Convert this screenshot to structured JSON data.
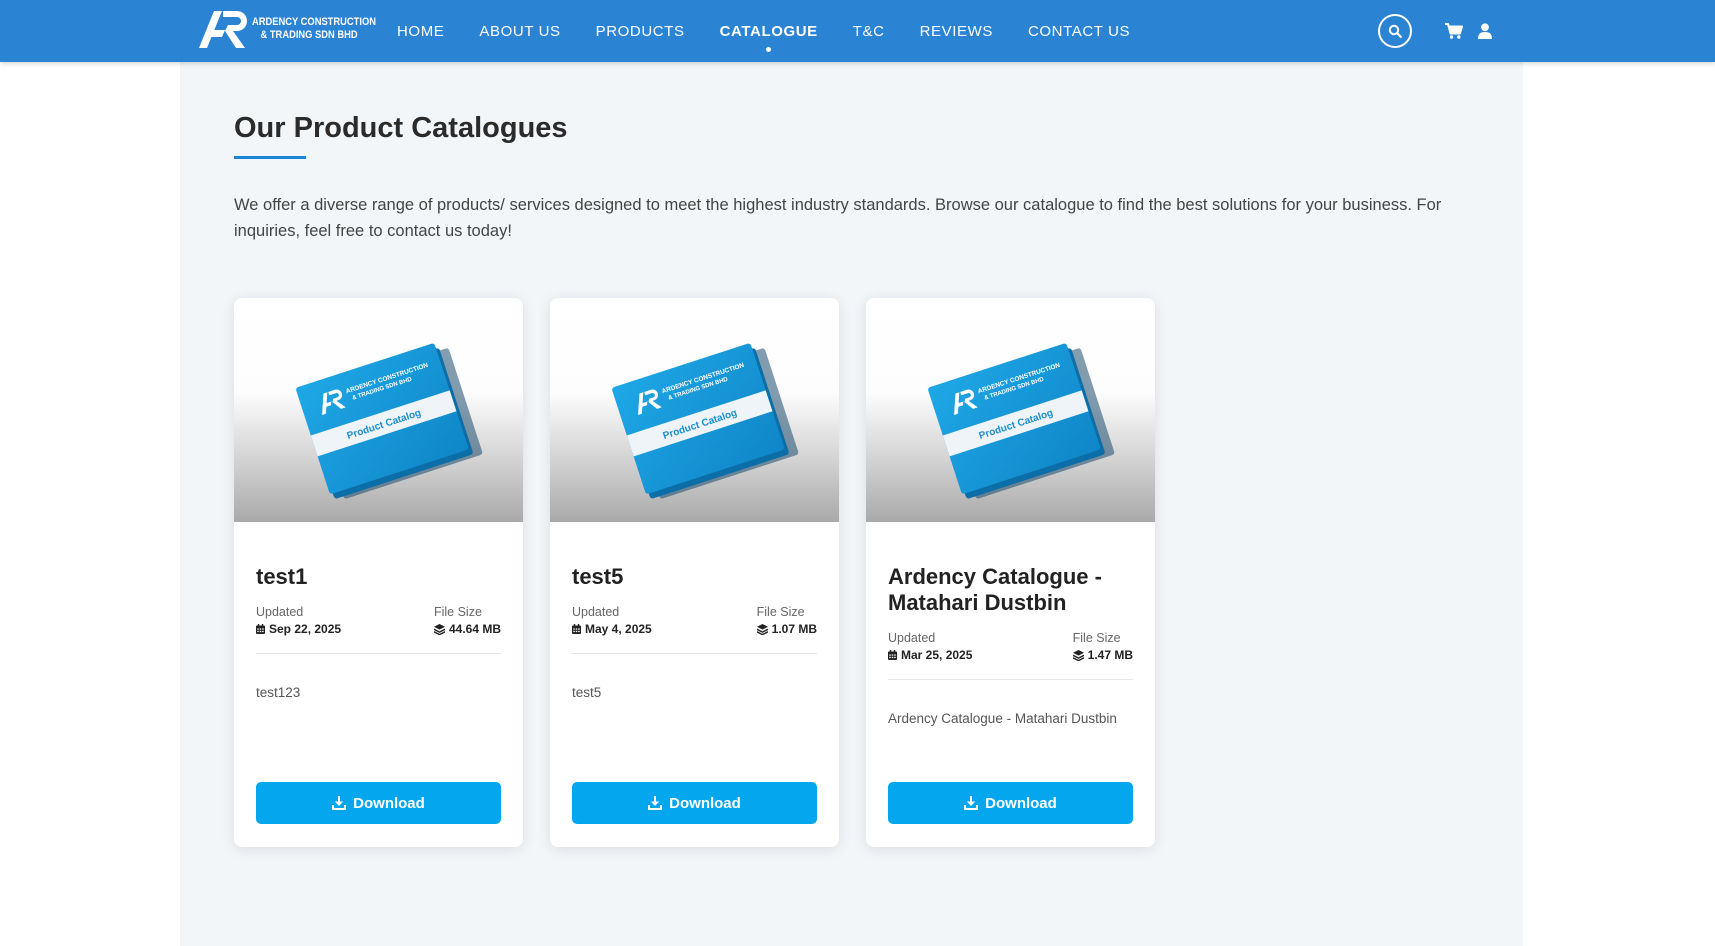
{
  "brand": {
    "logo_letters": "AR",
    "name_line1": "ARDENCY CONSTRUCTION",
    "name_line2": "& TRADING SDN BHD"
  },
  "nav": {
    "items": [
      {
        "label": "HOME",
        "active": false
      },
      {
        "label": "ABOUT US",
        "active": false
      },
      {
        "label": "PRODUCTS",
        "active": false
      },
      {
        "label": "CATALOGUE",
        "active": true
      },
      {
        "label": "T&C",
        "active": false
      },
      {
        "label": "REVIEWS",
        "active": false
      },
      {
        "label": "CONTACT US",
        "active": false
      }
    ],
    "icons": [
      "search-icon",
      "cart-icon",
      "user-icon"
    ]
  },
  "page": {
    "title": "Our Product Catalogues",
    "intro": "We offer a diverse range of products/ services designed to meet the highest industry standards. Browse our catalogue to find the best solutions for your business. For inquiries, feel free to contact us today!"
  },
  "cover": {
    "brand_line1": "ARDENCY CONSTRUCTION",
    "brand_line2": "& TRADING SDN BHD",
    "band_text": "Product Catalog"
  },
  "labels": {
    "updated": "Updated",
    "file_size": "File Size",
    "download": "Download"
  },
  "catalogues": [
    {
      "title": "test1",
      "updated": "Sep 22, 2025",
      "file_size": "44.64 MB",
      "description": "test123"
    },
    {
      "title": "test5",
      "updated": "May 4, 2025",
      "file_size": "1.07 MB",
      "description": "test5"
    },
    {
      "title": "Ardency Catalogue - Matahari Dustbin",
      "updated": "Mar 25, 2025",
      "file_size": "1.47 MB",
      "description": "Ardency Catalogue - Matahari Dustbin"
    }
  ],
  "colors": {
    "nav_bg": "#2a83d3",
    "accent": "#1a85d6",
    "button": "#04a6ee",
    "page_bg": "#f2f6f9",
    "cover_blue": "#1d9fdd"
  }
}
